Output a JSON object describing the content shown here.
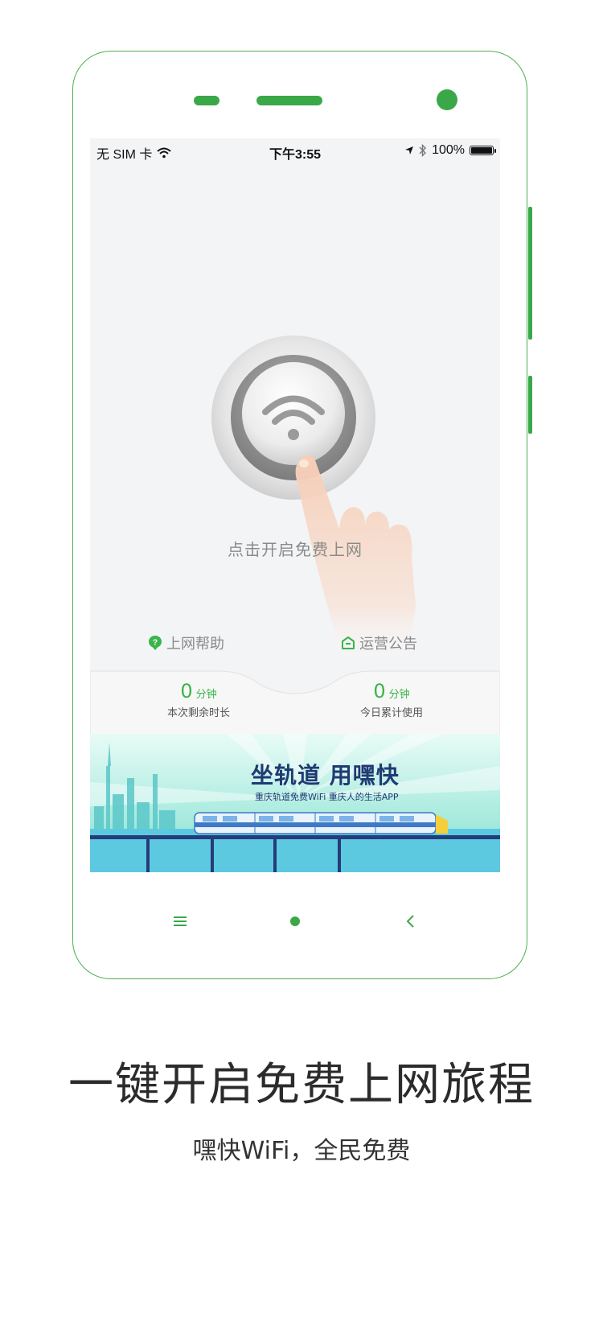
{
  "status_bar": {
    "carrier": "无 SIM 卡",
    "time": "下午3:55",
    "battery": "100%"
  },
  "main": {
    "press_text": "点击开启免费上网",
    "help_label": "上网帮助",
    "notice_label": "运营公告",
    "stats": [
      {
        "value": "0",
        "unit": "分钟",
        "label": "本次剩余时长"
      },
      {
        "value": "0",
        "unit": "分钟",
        "label": "今日累计使用"
      }
    ]
  },
  "banner": {
    "title": "坐轨道 用嘿快",
    "subtitle": "重庆轨道免费WiFi  重庆人的生活APP"
  },
  "promo": {
    "headline": "一键开启免费上网旅程",
    "subline": "嘿快WiFi，全民免费"
  },
  "colors": {
    "accent": "#3ab54a",
    "banner_navy": "#203a73",
    "screen_bg": "#f3f4f6"
  },
  "icons": [
    "wifi-icon",
    "location-arrow-icon",
    "bluetooth-icon",
    "battery-icon",
    "help-icon",
    "notice-icon",
    "menu-icon",
    "home-icon",
    "back-icon"
  ]
}
